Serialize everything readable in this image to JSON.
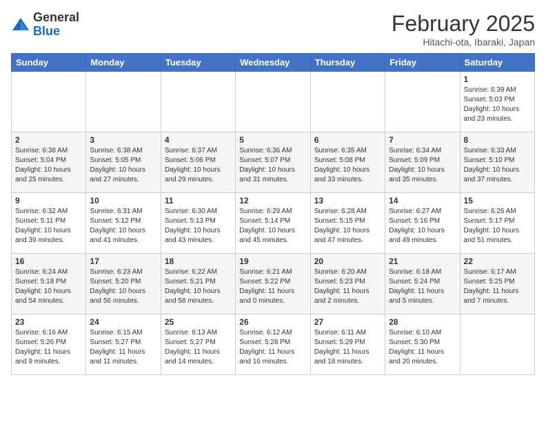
{
  "header": {
    "logo_general": "General",
    "logo_blue": "Blue",
    "month_title": "February 2025",
    "location": "Hitachi-ota, Ibaraki, Japan"
  },
  "weekdays": [
    "Sunday",
    "Monday",
    "Tuesday",
    "Wednesday",
    "Thursday",
    "Friday",
    "Saturday"
  ],
  "weeks": [
    [
      {
        "day": "",
        "info": ""
      },
      {
        "day": "",
        "info": ""
      },
      {
        "day": "",
        "info": ""
      },
      {
        "day": "",
        "info": ""
      },
      {
        "day": "",
        "info": ""
      },
      {
        "day": "",
        "info": ""
      },
      {
        "day": "1",
        "info": "Sunrise: 6:39 AM\nSunset: 5:03 PM\nDaylight: 10 hours and 23 minutes."
      }
    ],
    [
      {
        "day": "2",
        "info": "Sunrise: 6:38 AM\nSunset: 5:04 PM\nDaylight: 10 hours and 25 minutes."
      },
      {
        "day": "3",
        "info": "Sunrise: 6:38 AM\nSunset: 5:05 PM\nDaylight: 10 hours and 27 minutes."
      },
      {
        "day": "4",
        "info": "Sunrise: 6:37 AM\nSunset: 5:06 PM\nDaylight: 10 hours and 29 minutes."
      },
      {
        "day": "5",
        "info": "Sunrise: 6:36 AM\nSunset: 5:07 PM\nDaylight: 10 hours and 31 minutes."
      },
      {
        "day": "6",
        "info": "Sunrise: 6:35 AM\nSunset: 5:08 PM\nDaylight: 10 hours and 33 minutes."
      },
      {
        "day": "7",
        "info": "Sunrise: 6:34 AM\nSunset: 5:09 PM\nDaylight: 10 hours and 35 minutes."
      },
      {
        "day": "8",
        "info": "Sunrise: 6:33 AM\nSunset: 5:10 PM\nDaylight: 10 hours and 37 minutes."
      }
    ],
    [
      {
        "day": "9",
        "info": "Sunrise: 6:32 AM\nSunset: 5:11 PM\nDaylight: 10 hours and 39 minutes."
      },
      {
        "day": "10",
        "info": "Sunrise: 6:31 AM\nSunset: 5:12 PM\nDaylight: 10 hours and 41 minutes."
      },
      {
        "day": "11",
        "info": "Sunrise: 6:30 AM\nSunset: 5:13 PM\nDaylight: 10 hours and 43 minutes."
      },
      {
        "day": "12",
        "info": "Sunrise: 6:29 AM\nSunset: 5:14 PM\nDaylight: 10 hours and 45 minutes."
      },
      {
        "day": "13",
        "info": "Sunrise: 6:28 AM\nSunset: 5:15 PM\nDaylight: 10 hours and 47 minutes."
      },
      {
        "day": "14",
        "info": "Sunrise: 6:27 AM\nSunset: 5:16 PM\nDaylight: 10 hours and 49 minutes."
      },
      {
        "day": "15",
        "info": "Sunrise: 6:26 AM\nSunset: 5:17 PM\nDaylight: 10 hours and 51 minutes."
      }
    ],
    [
      {
        "day": "16",
        "info": "Sunrise: 6:24 AM\nSunset: 5:18 PM\nDaylight: 10 hours and 54 minutes."
      },
      {
        "day": "17",
        "info": "Sunrise: 6:23 AM\nSunset: 5:20 PM\nDaylight: 10 hours and 56 minutes."
      },
      {
        "day": "18",
        "info": "Sunrise: 6:22 AM\nSunset: 5:21 PM\nDaylight: 10 hours and 58 minutes."
      },
      {
        "day": "19",
        "info": "Sunrise: 6:21 AM\nSunset: 5:22 PM\nDaylight: 11 hours and 0 minutes."
      },
      {
        "day": "20",
        "info": "Sunrise: 6:20 AM\nSunset: 5:23 PM\nDaylight: 11 hours and 2 minutes."
      },
      {
        "day": "21",
        "info": "Sunrise: 6:18 AM\nSunset: 5:24 PM\nDaylight: 11 hours and 5 minutes."
      },
      {
        "day": "22",
        "info": "Sunrise: 6:17 AM\nSunset: 5:25 PM\nDaylight: 11 hours and 7 minutes."
      }
    ],
    [
      {
        "day": "23",
        "info": "Sunrise: 6:16 AM\nSunset: 5:26 PM\nDaylight: 11 hours and 9 minutes."
      },
      {
        "day": "24",
        "info": "Sunrise: 6:15 AM\nSunset: 5:27 PM\nDaylight: 11 hours and 11 minutes."
      },
      {
        "day": "25",
        "info": "Sunrise: 6:13 AM\nSunset: 5:27 PM\nDaylight: 11 hours and 14 minutes."
      },
      {
        "day": "26",
        "info": "Sunrise: 6:12 AM\nSunset: 5:28 PM\nDaylight: 11 hours and 16 minutes."
      },
      {
        "day": "27",
        "info": "Sunrise: 6:11 AM\nSunset: 5:29 PM\nDaylight: 11 hours and 18 minutes."
      },
      {
        "day": "28",
        "info": "Sunrise: 6:10 AM\nSunset: 5:30 PM\nDaylight: 11 hours and 20 minutes."
      },
      {
        "day": "",
        "info": ""
      }
    ]
  ]
}
